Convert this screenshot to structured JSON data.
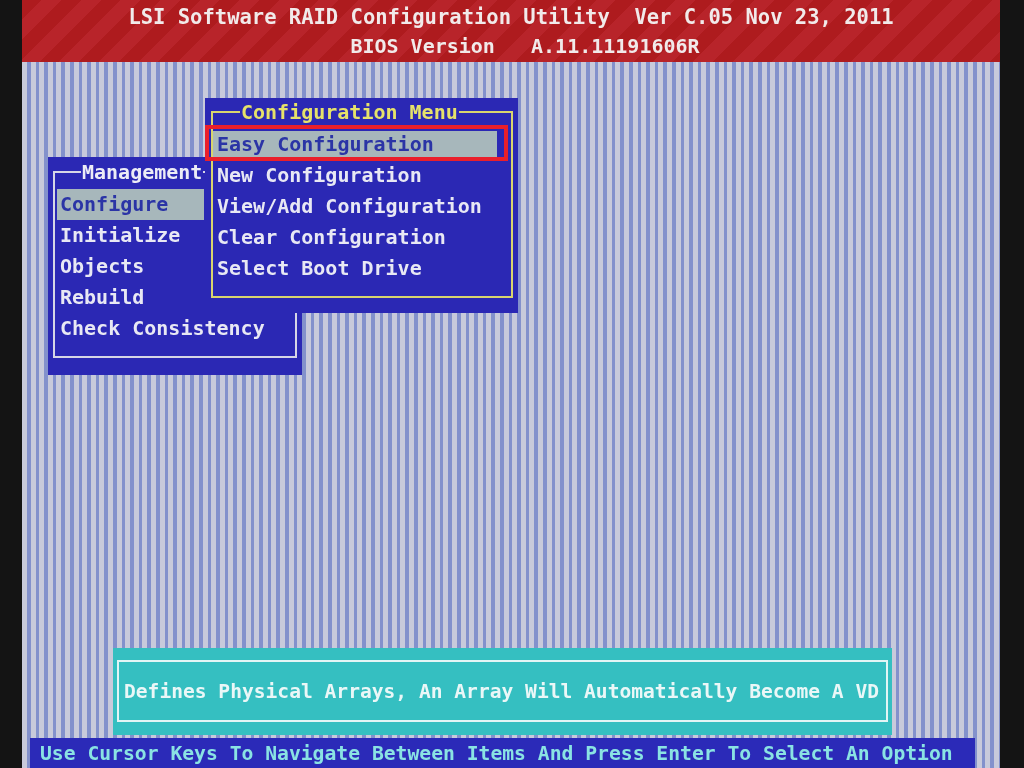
{
  "header": {
    "title": "LSI Software RAID Configuration Utility  Ver C.05 Nov 23, 2011",
    "subtitle": "BIOS Version   A.11.11191606R"
  },
  "management_menu": {
    "title": "Management",
    "items": [
      {
        "label": "Configure",
        "selected": true
      },
      {
        "label": "Initialize",
        "selected": false
      },
      {
        "label": "Objects",
        "selected": false
      },
      {
        "label": "Rebuild",
        "selected": false
      },
      {
        "label": "Check Consistency",
        "selected": false
      }
    ]
  },
  "configuration_menu": {
    "title": "Configuration Menu",
    "items": [
      {
        "label": "Easy Configuration",
        "selected": true
      },
      {
        "label": "New Configuration",
        "selected": false
      },
      {
        "label": "View/Add Configuration",
        "selected": false
      },
      {
        "label": "Clear Configuration",
        "selected": false
      },
      {
        "label": "Select Boot Drive",
        "selected": false
      }
    ]
  },
  "help_text": "Defines Physical Arrays, An Array Will Automatically Become A VD",
  "status_bar": "Use Cursor Keys To Navigate Between Items And Press Enter To Select An Option"
}
